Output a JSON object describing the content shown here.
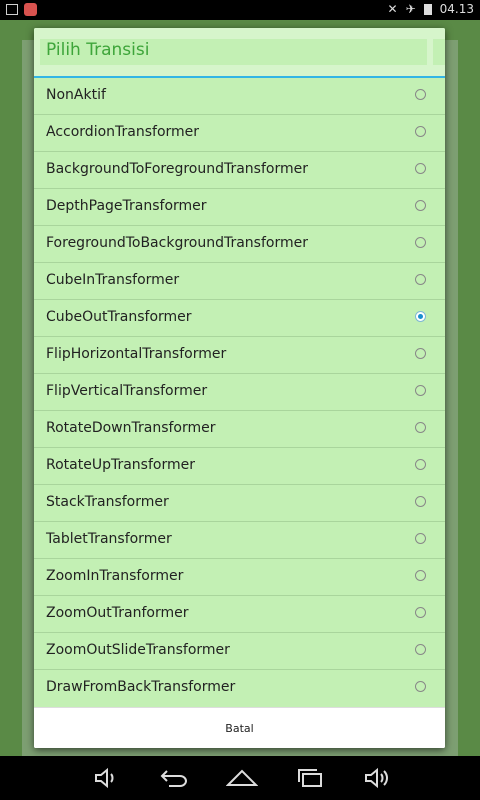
{
  "status_bar": {
    "time": "04.13",
    "icons": [
      "image-icon",
      "notification-app-icon",
      "mute-icon",
      "airplane-mode-icon",
      "battery-icon"
    ]
  },
  "dialog": {
    "title": "Pilih Transisi",
    "options": [
      {
        "label": "NonAktif",
        "selected": false
      },
      {
        "label": "AccordionTransformer",
        "selected": false
      },
      {
        "label": "BackgroundToForegroundTransformer",
        "selected": false
      },
      {
        "label": "DepthPageTransformer",
        "selected": false
      },
      {
        "label": "ForegroundToBackgroundTransformer",
        "selected": false
      },
      {
        "label": "CubeInTransformer",
        "selected": false
      },
      {
        "label": "CubeOutTransformer",
        "selected": true
      },
      {
        "label": "FlipHorizontalTransformer",
        "selected": false
      },
      {
        "label": "FlipVerticalTransformer",
        "selected": false
      },
      {
        "label": "RotateDownTransformer",
        "selected": false
      },
      {
        "label": "RotateUpTransformer",
        "selected": false
      },
      {
        "label": "StackTransformer",
        "selected": false
      },
      {
        "label": "TabletTransformer",
        "selected": false
      },
      {
        "label": "ZoomInTransformer",
        "selected": false
      },
      {
        "label": "ZoomOutTranformer",
        "selected": false
      },
      {
        "label": "ZoomOutSlideTransformer",
        "selected": false
      },
      {
        "label": "DrawFromBackTransformer",
        "selected": false
      }
    ],
    "cancel_label": "Batal"
  },
  "nav_bar": {
    "buttons": [
      "volume-down-icon",
      "back-icon",
      "home-icon",
      "recent-apps-icon",
      "volume-up-icon"
    ]
  },
  "colors": {
    "dialog_bg": "#c3f0b4",
    "title_text": "#3ea53a",
    "title_divider": "#33b5e5",
    "radio_selected": "#1a8ed0"
  }
}
